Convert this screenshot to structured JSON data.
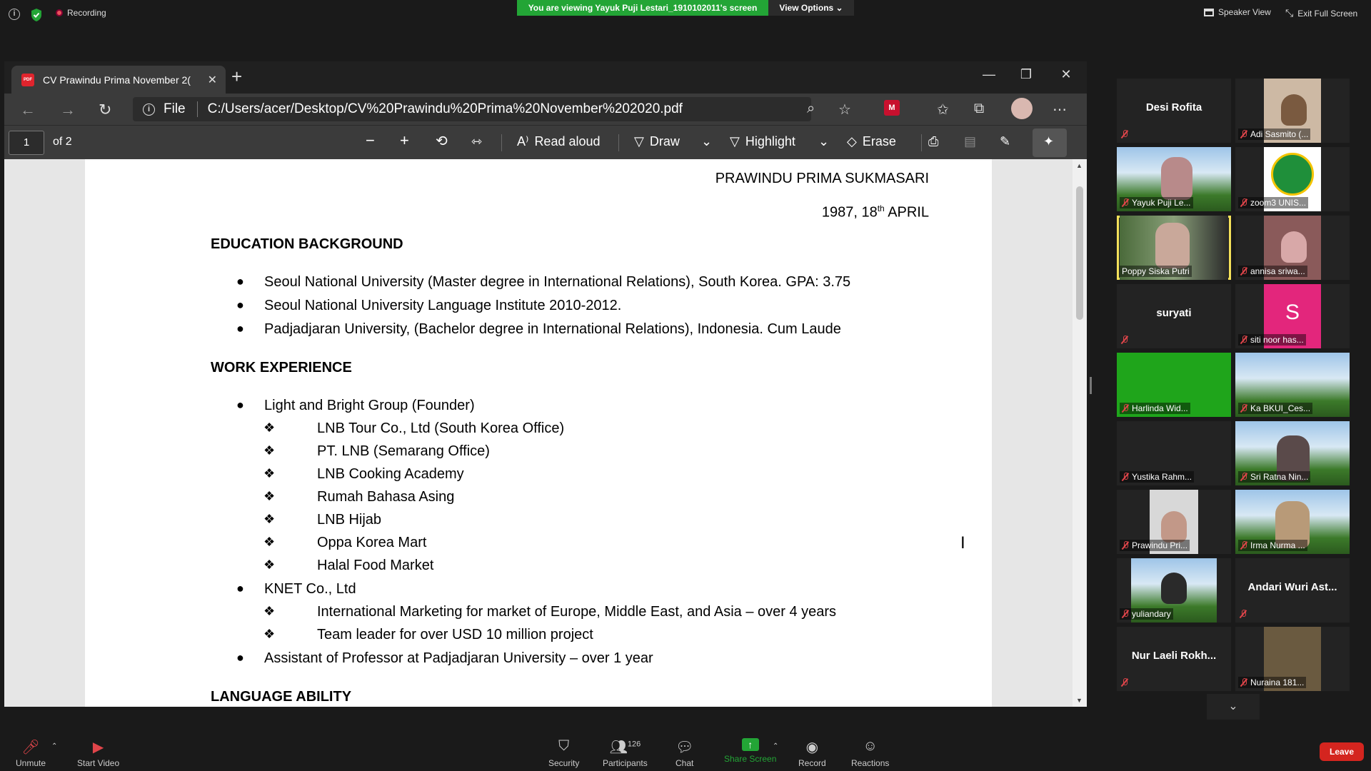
{
  "zoom": {
    "recording": "Recording",
    "viewing_banner": "You are viewing Yayuk Puji Lestari_1910102011's screen",
    "view_options": "View Options ⌄",
    "speaker_view": "Speaker View",
    "exit_full_screen": "Exit Full Screen"
  },
  "browser": {
    "tab_title": "CV Prawindu Prima November 2(",
    "file_label": "File",
    "url": "C:/Users/acer/Desktop/CV%20Prawindu%20Prima%20November%202020.pdf",
    "page_current": "1",
    "page_total": "of 2",
    "read_aloud": "Read aloud",
    "draw": "Draw",
    "highlight": "Highlight",
    "erase": "Erase"
  },
  "doc": {
    "name": "PRAWINDU PRIMA SUKMASARI",
    "dob_pre": "1987, 18",
    "dob_sup": "th",
    "dob_post": " APRIL",
    "edu_heading": "EDUCATION BACKGROUND",
    "education": [
      "Seoul National University (Master degree in International Relations), South Korea. GPA: 3.75",
      "Seoul National University Language Institute 2010-2012.",
      "Padjadjaran University, (Bachelor degree in International Relations), Indonesia. Cum Laude"
    ],
    "work_heading": "WORK EXPERIENCE",
    "work1": "Light and Bright Group (Founder)",
    "work1_sub": [
      "LNB Tour Co., Ltd (South Korea Office)",
      "PT. LNB (Semarang Office)",
      "LNB Cooking Academy",
      "Rumah Bahasa Asing",
      "LNB Hijab",
      "Oppa Korea Mart",
      "Halal Food Market"
    ],
    "work2": "KNET Co., Ltd",
    "work2_sub": [
      "International Marketing for market of Europe, Middle East, and Asia – over 4 years",
      "Team leader for over USD 10 million project"
    ],
    "work3": "Assistant of Professor at Padjadjaran University – over 1 year",
    "next_heading": "LANGUAGE ABILITY"
  },
  "participants": [
    {
      "name": "Desi Rofita",
      "type": "name"
    },
    {
      "name": "Adi Sasmito (...",
      "type": "video"
    },
    {
      "name": "Yayuk Puji Le...",
      "type": "video"
    },
    {
      "name": "zoom3 UNIS...",
      "type": "video"
    },
    {
      "name": "Poppy Siska Putri",
      "type": "video"
    },
    {
      "name": "annisa sriwa...",
      "type": "video"
    },
    {
      "name": "suryati",
      "type": "name"
    },
    {
      "name": "siti noor has...",
      "type": "avatar",
      "initial": "S"
    },
    {
      "name": "Harlinda Wid...",
      "type": "video"
    },
    {
      "name": "Ka BKUI_Ces...",
      "type": "video"
    },
    {
      "name": "Yustika Rahm...",
      "type": "video"
    },
    {
      "name": "Sri Ratna Nin...",
      "type": "video"
    },
    {
      "name": "Prawindu Pri...",
      "type": "video"
    },
    {
      "name": "Irma Nurma ...",
      "type": "video"
    },
    {
      "name": "yuliandary",
      "type": "video"
    },
    {
      "name": "Andari Wuri Ast...",
      "type": "name"
    },
    {
      "name": "Nur Laeli Rokh...",
      "type": "name"
    },
    {
      "name": "Nuraina 181...",
      "type": "video"
    }
  ],
  "toolbar": {
    "unmute": "Unmute",
    "start_video": "Start Video",
    "security": "Security",
    "participants": "Participants",
    "participant_count": "126",
    "chat": "Chat",
    "share_screen": "Share Screen",
    "record": "Record",
    "reactions": "Reactions",
    "leave": "Leave"
  },
  "colors": {
    "zoom_green": "#23a536",
    "leave_red": "#d4251f",
    "speaker_highlight": "#f4e15a"
  }
}
